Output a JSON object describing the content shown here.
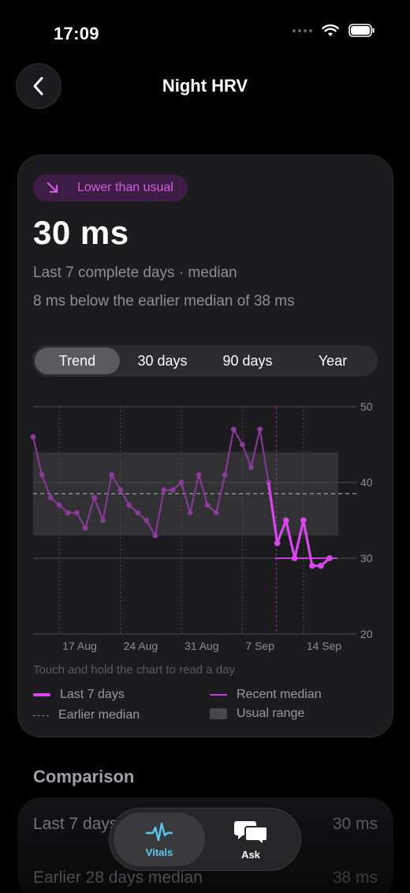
{
  "status": {
    "time": "17:09"
  },
  "nav": {
    "title": "Night HRV"
  },
  "summary": {
    "badge": "Lower than usual",
    "value": "30 ms",
    "subtitle": "Last 7 complete days · median",
    "detail": "8 ms below the earlier median of 38 ms"
  },
  "segments": [
    "Trend",
    "30 days",
    "90 days",
    "Year"
  ],
  "segments_active": "Trend",
  "chart_data": {
    "type": "line",
    "y_ticks": [
      "20",
      "30",
      "40",
      "50"
    ],
    "x_ticks": [
      "17 Aug",
      "24 Aug",
      "31 Aug",
      "7 Sep",
      "14 Sep"
    ],
    "ylim": [
      20,
      50
    ],
    "earlier_median": 38.5,
    "recent_median": 30,
    "usual_range": [
      33,
      44
    ],
    "series": [
      {
        "values": [
          46,
          41,
          38,
          37,
          36,
          36,
          34,
          38,
          35,
          41,
          39,
          37,
          36,
          35,
          33,
          39,
          39,
          40,
          36,
          41,
          37,
          36,
          41,
          47,
          45,
          42,
          47,
          40
        ]
      },
      {
        "values": [
          40,
          32,
          35,
          30,
          35,
          29,
          29,
          30
        ]
      }
    ]
  },
  "chart_hint": "Touch and hold the chart to read a day",
  "legend": {
    "last7": "Last 7 days",
    "recent_median": "Recent median",
    "earlier_median": "Earlier median",
    "usual_range": "Usual range"
  },
  "comparison": {
    "title": "Comparison",
    "rows": [
      {
        "label": "Last 7 days",
        "value": "30 ms"
      },
      {
        "label": "Earlier 28 days median",
        "value": "38 ms"
      }
    ]
  },
  "tabs": [
    {
      "label": "Vitals",
      "icon": "vitals-icon"
    },
    {
      "label": "Ask",
      "icon": "chat-bubbles-icon"
    }
  ],
  "colors": {
    "accent": "#d946ef",
    "accent_dim": "#8a3a9a",
    "tab_active": "#5ac8f5"
  }
}
